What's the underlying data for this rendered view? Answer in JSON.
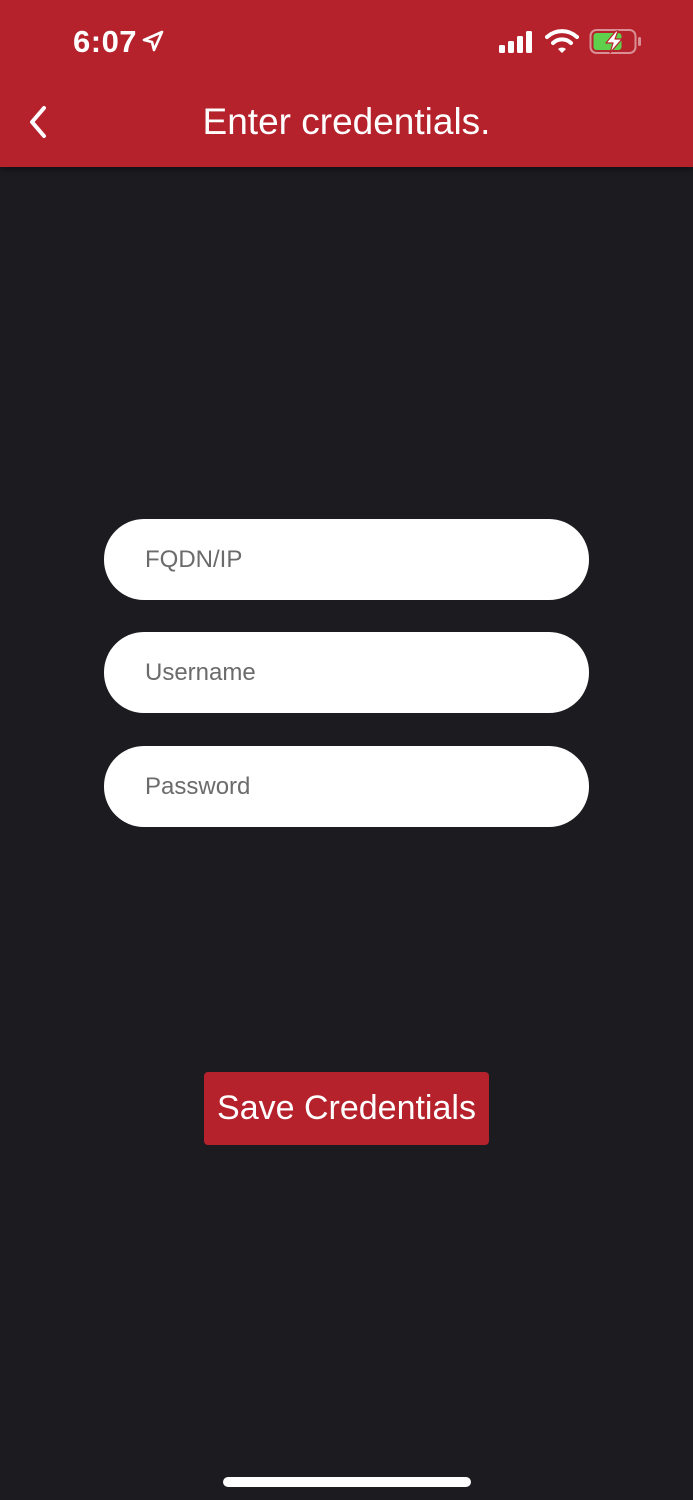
{
  "status_bar": {
    "time": "6:07",
    "icons": [
      "location-arrow-icon",
      "cellular-signal-icon",
      "wifi-icon",
      "battery-charging-icon"
    ]
  },
  "nav": {
    "back_icon": "chevron-left-icon",
    "title": "Enter credentials."
  },
  "form": {
    "fqdn_placeholder": "FQDN/IP",
    "username_placeholder": "Username",
    "password_placeholder": "Password",
    "save_label": "Save Credentials"
  },
  "colors": {
    "accent": "#b5222c",
    "background": "#1c1b20",
    "battery_fill": "#5fd04b"
  }
}
